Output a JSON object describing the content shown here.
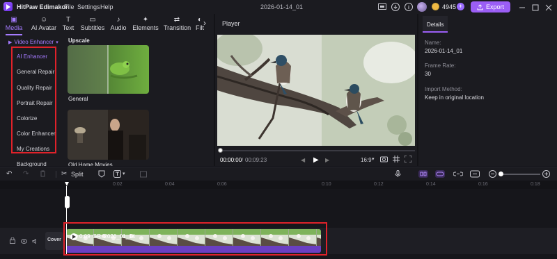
{
  "app": {
    "title": "HitPaw Edimakor",
    "project": "2026-01-14_01",
    "credits": "4945",
    "export_label": "Export"
  },
  "menu": [
    "File",
    "Settings",
    "Help"
  ],
  "tabs": [
    {
      "label": "Media",
      "icon": "media-icon"
    },
    {
      "label": "AI Avatar",
      "icon": "ai-avatar-icon"
    },
    {
      "label": "Text",
      "icon": "text-icon"
    },
    {
      "label": "Subtitles",
      "icon": "subtitles-icon"
    },
    {
      "label": "Audio",
      "icon": "audio-icon"
    },
    {
      "label": "Elements",
      "icon": "elements-icon"
    },
    {
      "label": "Transition",
      "icon": "transition-icon"
    },
    {
      "label": "Filt",
      "icon": "filter-icon"
    }
  ],
  "sidebar": {
    "category": "Video Enhancer",
    "items": [
      "AI Enhancer",
      "General Repair",
      "Quality Repair",
      "Portrait Repair",
      "Colorize",
      "Color Enhancer"
    ],
    "extra": [
      "My Creations",
      "Background"
    ]
  },
  "gallery": {
    "section": "Upscale",
    "items": [
      "General",
      "Old Home Movies"
    ]
  },
  "player": {
    "title": "Player",
    "current_time": "00:00:00",
    "separator": "/",
    "total_time": "00:09:23",
    "aspect": "16:9"
  },
  "details": {
    "tab": "Details",
    "fields": [
      {
        "label": "Name:",
        "value": "2026-01-14_01"
      },
      {
        "label": "Frame Rate:",
        "value": "30"
      },
      {
        "label": "Import Method:",
        "value": "Keep in original location"
      }
    ]
  },
  "timeline": {
    "split_label": "Split",
    "ticks": [
      "0:02",
      "0:04",
      "0:06",
      "0:10",
      "0:12",
      "0:14",
      "0:16",
      "0:18"
    ],
    "cover_label": "Cover",
    "clip_duration": "0:09",
    "clip_name": "GR_2026_01_14"
  },
  "colors": {
    "accent": "#9b5ef5",
    "highlight": "#e0222a",
    "clip_bar": "#6a3fc2"
  }
}
